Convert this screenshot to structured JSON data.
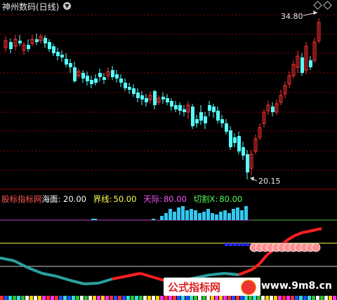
{
  "header": {
    "title": "神州数码(日线)",
    "dropdown_icon": "chevron-down-icon",
    "controls": [
      "diamond-icon",
      "diamond-icon"
    ]
  },
  "price_chart": {
    "high_label": "34.80",
    "low_label": "20.15",
    "colors": {
      "up": "#ff3232",
      "down": "#54ffff",
      "grid": "#8b0000"
    }
  },
  "indicator": {
    "name": "股标指标网",
    "params": [
      {
        "label": "海面:",
        "value": "20.00",
        "color": "#ffffff"
      },
      {
        "label": "界线:",
        "value": "50.00",
        "color": "#ffff54"
      },
      {
        "label": "天际:",
        "value": "80.00",
        "color": "#ff54ff"
      },
      {
        "label": "切割X:",
        "value": "80.00",
        "color": "#54ff54"
      }
    ]
  },
  "watermark": {
    "text": "公式指标网",
    "url": "www.9m8.cn"
  }
}
